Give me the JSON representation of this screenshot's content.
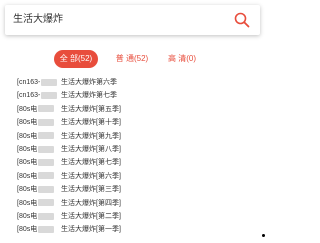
{
  "search": {
    "query": "生活大爆炸"
  },
  "tabs": [
    {
      "label": "全 部(52)"
    },
    {
      "label": "普 通(52)"
    },
    {
      "label": "高 清(0)"
    }
  ],
  "results": [
    {
      "source": "[cn163-",
      "title": "生活大爆炸第六季"
    },
    {
      "source": "[cn163-",
      "title": "生活大爆炸第七季"
    },
    {
      "source": "[80s电",
      "title": "生活大爆炸[第五季]"
    },
    {
      "source": "[80s电",
      "title": "生活大爆炸[第十季]"
    },
    {
      "source": "[80s电",
      "title": "生活大爆炸[第九季]"
    },
    {
      "source": "[80s电",
      "title": "生活大爆炸[第八季]"
    },
    {
      "source": "[80s电",
      "title": "生活大爆炸[第七季]"
    },
    {
      "source": "[80s电",
      "title": "生活大爆炸[第六季]"
    },
    {
      "source": "[80s电",
      "title": "生活大爆炸[第三季]"
    },
    {
      "source": "[80s电",
      "title": "生活大爆炸[第四季]"
    },
    {
      "source": "[80s电",
      "title": "生活大爆炸[第二季]"
    },
    {
      "source": "[80s电",
      "title": "生活大爆炸[第一季]"
    }
  ],
  "colors": {
    "accent": "#e84d3c",
    "text": "#333333"
  }
}
